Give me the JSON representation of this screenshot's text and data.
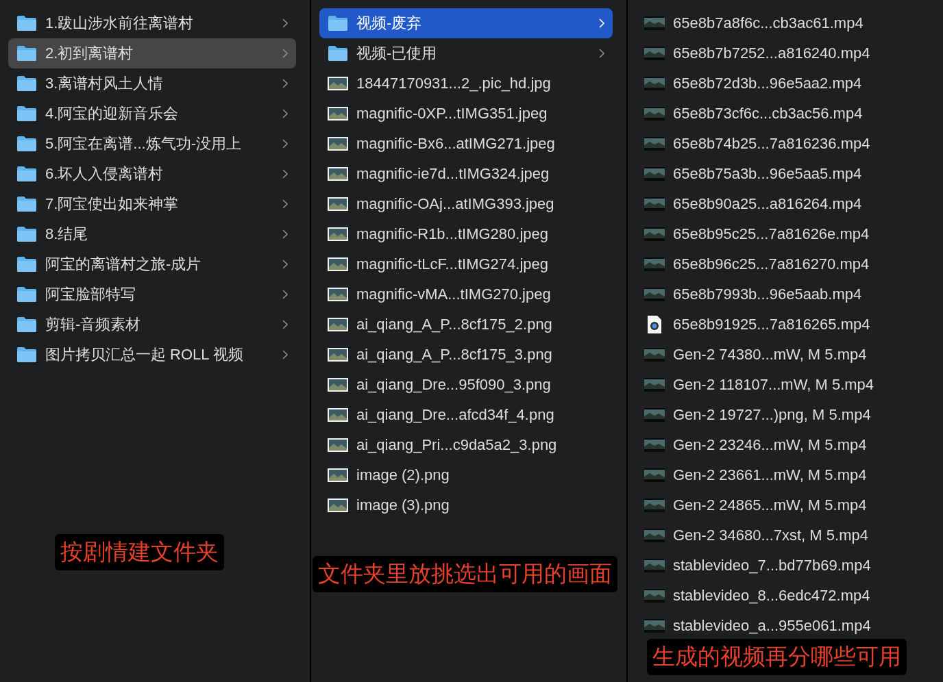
{
  "columns": [
    {
      "focused": false,
      "items": [
        {
          "kind": "folder",
          "name": "1.跋山涉水前往离谱村",
          "selected": false
        },
        {
          "kind": "folder",
          "name": "2.初到离谱村",
          "selected": true
        },
        {
          "kind": "folder",
          "name": "3.离谱村风土人情",
          "selected": false
        },
        {
          "kind": "folder",
          "name": "4.阿宝的迎新音乐会",
          "selected": false
        },
        {
          "kind": "folder",
          "name": "5.阿宝在离谱...炼气功-没用上",
          "selected": false
        },
        {
          "kind": "folder",
          "name": "6.坏人入侵离谱村",
          "selected": false
        },
        {
          "kind": "folder",
          "name": "7.阿宝使出如来神掌",
          "selected": false
        },
        {
          "kind": "folder",
          "name": "8.结尾",
          "selected": false
        },
        {
          "kind": "folder",
          "name": "阿宝的离谱村之旅-成片",
          "selected": false
        },
        {
          "kind": "folder",
          "name": "阿宝脸部特写",
          "selected": false
        },
        {
          "kind": "folder",
          "name": "剪辑-音频素材",
          "selected": false
        },
        {
          "kind": "folder",
          "name": "图片拷贝汇总一起 ROLL 视频",
          "selected": false
        }
      ],
      "caption": "按剧情建文件夹"
    },
    {
      "focused": true,
      "items": [
        {
          "kind": "folder",
          "name": "视频-废弃",
          "selected": true
        },
        {
          "kind": "folder",
          "name": "视频-已使用",
          "selected": false
        },
        {
          "kind": "image",
          "name": "18447170931...2_.pic_hd.jpg",
          "selected": false
        },
        {
          "kind": "image",
          "name": "magnific-0XP...tIMG351.jpeg",
          "selected": false
        },
        {
          "kind": "image",
          "name": "magnific-Bx6...atIMG271.jpeg",
          "selected": false
        },
        {
          "kind": "image",
          "name": "magnific-ie7d...tIMG324.jpeg",
          "selected": false
        },
        {
          "kind": "image",
          "name": "magnific-OAj...atIMG393.jpeg",
          "selected": false
        },
        {
          "kind": "image",
          "name": "magnific-R1b...tIMG280.jpeg",
          "selected": false
        },
        {
          "kind": "image",
          "name": "magnific-tLcF...tIMG274.jpeg",
          "selected": false
        },
        {
          "kind": "image",
          "name": "magnific-vMA...tIMG270.jpeg",
          "selected": false
        },
        {
          "kind": "image",
          "name": "ai_qiang_A_P...8cf175_2.png",
          "selected": false
        },
        {
          "kind": "image",
          "name": "ai_qiang_A_P...8cf175_3.png",
          "selected": false
        },
        {
          "kind": "image",
          "name": "ai_qiang_Dre...95f090_3.png",
          "selected": false
        },
        {
          "kind": "image",
          "name": "ai_qiang_Dre...afcd34f_4.png",
          "selected": false
        },
        {
          "kind": "image",
          "name": "ai_qiang_Pri...c9da5a2_3.png",
          "selected": false
        },
        {
          "kind": "image",
          "name": "image (2).png",
          "selected": false
        },
        {
          "kind": "image",
          "name": "image (3).png",
          "selected": false
        }
      ],
      "caption": "文件夹里放挑选出可用的画面"
    },
    {
      "items": [
        {
          "kind": "video",
          "name": "65e8b7a8f6c...cb3ac61.mp4",
          "selected": false
        },
        {
          "kind": "video",
          "name": "65e8b7b7252...a816240.mp4",
          "selected": false
        },
        {
          "kind": "video",
          "name": "65e8b72d3b...96e5aa2.mp4",
          "selected": false
        },
        {
          "kind": "video",
          "name": "65e8b73cf6c...cb3ac56.mp4",
          "selected": false
        },
        {
          "kind": "video",
          "name": "65e8b74b25...7a816236.mp4",
          "selected": false
        },
        {
          "kind": "video",
          "name": "65e8b75a3b...96e5aa5.mp4",
          "selected": false
        },
        {
          "kind": "video",
          "name": "65e8b90a25...a816264.mp4",
          "selected": false
        },
        {
          "kind": "video",
          "name": "65e8b95c25...7a81626e.mp4",
          "selected": false
        },
        {
          "kind": "video",
          "name": "65e8b96c25...7a816270.mp4",
          "selected": false
        },
        {
          "kind": "video",
          "name": "65e8b7993b...96e5aab.mp4",
          "selected": false
        },
        {
          "kind": "document",
          "name": "65e8b91925...7a816265.mp4",
          "selected": false
        },
        {
          "kind": "video",
          "name": "Gen-2 74380...mW, M 5.mp4",
          "selected": false
        },
        {
          "kind": "video",
          "name": "Gen-2 118107...mW, M 5.mp4",
          "selected": false
        },
        {
          "kind": "video",
          "name": "Gen-2 19727...)png, M 5.mp4",
          "selected": false
        },
        {
          "kind": "video",
          "name": "Gen-2 23246...mW, M 5.mp4",
          "selected": false
        },
        {
          "kind": "video",
          "name": "Gen-2 23661...mW, M 5.mp4",
          "selected": false
        },
        {
          "kind": "video",
          "name": "Gen-2 24865...mW, M 5.mp4",
          "selected": false
        },
        {
          "kind": "video",
          "name": "Gen-2 34680...7xst, M 5.mp4",
          "selected": false
        },
        {
          "kind": "video",
          "name": "stablevideo_7...bd77b69.mp4",
          "selected": false
        },
        {
          "kind": "video",
          "name": "stablevideo_8...6edc472.mp4",
          "selected": false
        },
        {
          "kind": "video",
          "name": "stablevideo_a...955e061.mp4",
          "selected": false
        }
      ],
      "caption": "生成的视频再分哪些可用"
    }
  ]
}
